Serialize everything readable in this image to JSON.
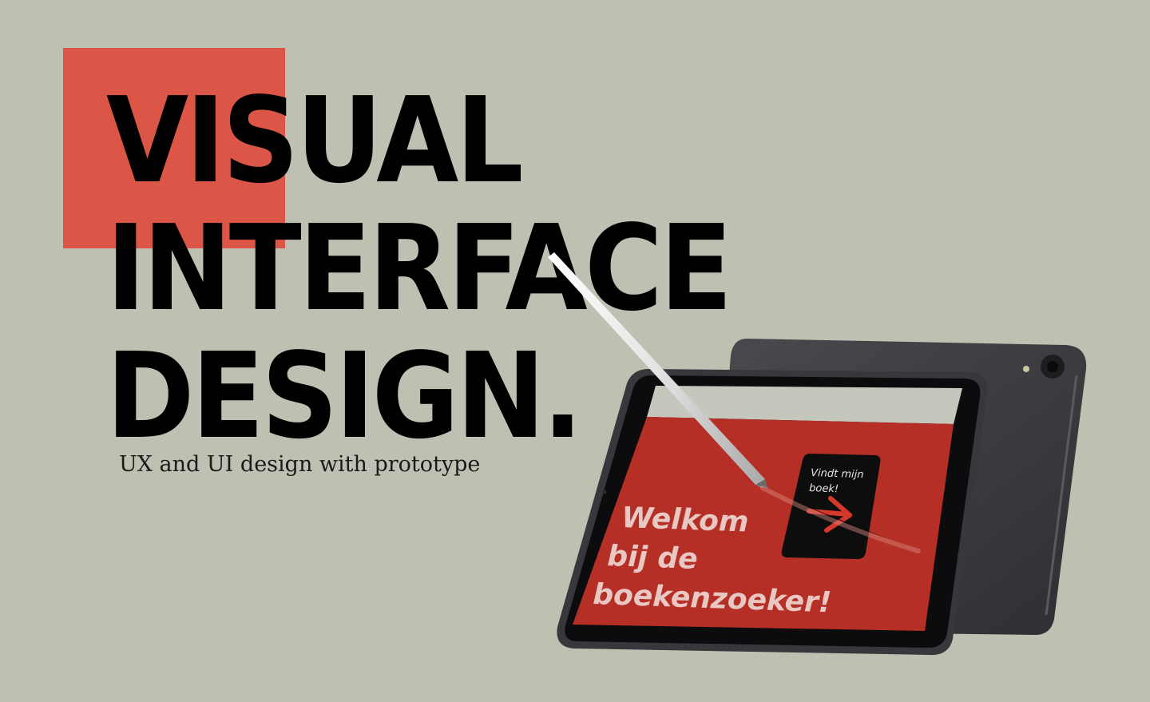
{
  "hero": {
    "title_lines": [
      "VISUAL",
      "INTERFACE",
      "DESIGN."
    ],
    "subtitle": "UX and UI design with prototype"
  },
  "tablet_screen": {
    "welcome_lines": [
      "Welkom",
      "bij de",
      "boekenzoeker!"
    ],
    "cta_lines": [
      "Vindt mijn",
      "boek!"
    ],
    "cta_icon": "arrow-right-icon"
  },
  "colors": {
    "background": "#bfc0b1",
    "accent": "#db5647",
    "screen_red": "#b52f26",
    "text": "#000000"
  }
}
